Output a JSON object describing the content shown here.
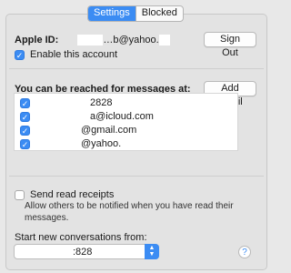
{
  "tabs": [
    {
      "label": "Settings",
      "active": true
    },
    {
      "label": "Blocked",
      "active": false
    }
  ],
  "account": {
    "apple_id_label": "Apple ID:",
    "apple_id_value": "…b@yahoo.",
    "sign_out_label": "Sign Out",
    "enable_label": "Enable this account",
    "enable_checked": true
  },
  "reach": {
    "heading": "You can be reached for messages at:",
    "add_email_label": "Add Email",
    "items": [
      {
        "text": "2828",
        "checked": true
      },
      {
        "text": "a@icloud.com",
        "checked": true
      },
      {
        "text": "@gmail.com",
        "checked": true
      },
      {
        "text": "@yahoo.",
        "checked": true
      }
    ]
  },
  "read_receipts": {
    "label": "Send read receipts",
    "checked": false,
    "description": "Allow others to be notified when you have read their messages."
  },
  "start_from": {
    "label": "Start new conversations from:",
    "value": ":828"
  },
  "help_label": "?",
  "colors": {
    "accent": "#3b8cf3"
  }
}
